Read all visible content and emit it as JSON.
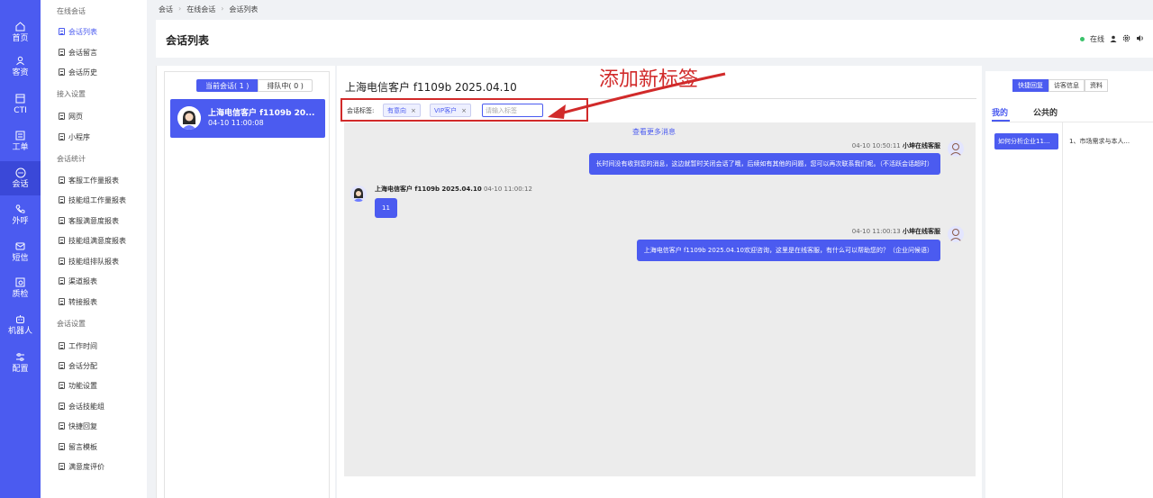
{
  "rail": {
    "items": [
      {
        "label": "首页",
        "icon": "home-icon"
      },
      {
        "label": "客资",
        "icon": "users-icon"
      },
      {
        "label": "CTI",
        "icon": "cti-icon"
      },
      {
        "label": "工单",
        "icon": "ticket-icon"
      },
      {
        "label": "会话",
        "icon": "chat-icon"
      },
      {
        "label": "外呼",
        "icon": "phone-out-icon"
      },
      {
        "label": "短信",
        "icon": "sms-icon"
      },
      {
        "label": "质检",
        "icon": "inspect-icon"
      },
      {
        "label": "机器人",
        "icon": "robot-icon"
      },
      {
        "label": "配置",
        "icon": "settings-icon"
      }
    ],
    "active_index": 4
  },
  "menu": {
    "groups": {
      "online": "在线会话",
      "access": "接入设置",
      "stats": "会话统计",
      "settings": "会话设置"
    },
    "items": {
      "list": "会话列表",
      "leave": "会话留言",
      "history": "会话历史",
      "web": "网页",
      "miniapp": "小程序",
      "agent_work": "客服工作量报表",
      "group_work": "技能组工作量报表",
      "agent_satisfaction": "客服满意度报表",
      "group_satisfaction": "技能组满意度报表",
      "group_queue": "技能组排队报表",
      "channel": "渠道报表",
      "transfer": "转接报表",
      "work_time": "工作时间",
      "allocation": "会话分配",
      "features": "功能设置",
      "skill_group": "会话技能组",
      "quick_reply": "快捷回复",
      "leave_template": "留言模板",
      "satisfaction": "满意度评价"
    }
  },
  "breadcrumb": [
    "会话",
    "在线会话",
    "会话列表"
  ],
  "page": {
    "title": "会话列表",
    "status": "在线"
  },
  "session_list": {
    "tab_current": "当前会话( 1 )",
    "tab_queue": "排队中( 0 )",
    "card": {
      "name": "上海电信客户 f1109b 20...",
      "time": "04-10 11:00:08"
    }
  },
  "chat": {
    "title": "上海电信客户 f1109b 2025.04.10",
    "tags_label": "会话标签:",
    "tags": [
      "有意向",
      "VIP客户"
    ],
    "tag_input_placeholder": "请输入标签",
    "annotation": "添加新标签",
    "load_more": "查看更多消息",
    "messages": [
      {
        "side": "right",
        "time": "04-10 10:50:11",
        "sender": "小坤在线客服",
        "text": "长时间没有收到您的消息，这边就暂时关闭会话了哦，后续如有其他的问题，您可以再次联系我们呢。（不活跃会话超时）"
      },
      {
        "side": "left",
        "time": "04-10 11:00:12",
        "sender": "上海电信客户 f1109b 2025.04.10",
        "text": "11"
      },
      {
        "side": "right",
        "time": "04-10 11:00:13",
        "sender": "小坤在线客服",
        "text": "上海电信客户 f1109b 2025.04.10欢迎咨询，这里是在线客服，有什么可以帮助您的？（企业问候语）"
      }
    ]
  },
  "right_panel": {
    "tabs": [
      "快捷回复",
      "访客信息",
      "资料"
    ],
    "subtabs": [
      "我的",
      "公共的"
    ],
    "category": "如何分析企业11...",
    "item": "1、市场需求与本人..."
  },
  "colors": {
    "primary": "#4b5bf0",
    "annotation": "#d12a2a",
    "online": "#3ac26a"
  }
}
